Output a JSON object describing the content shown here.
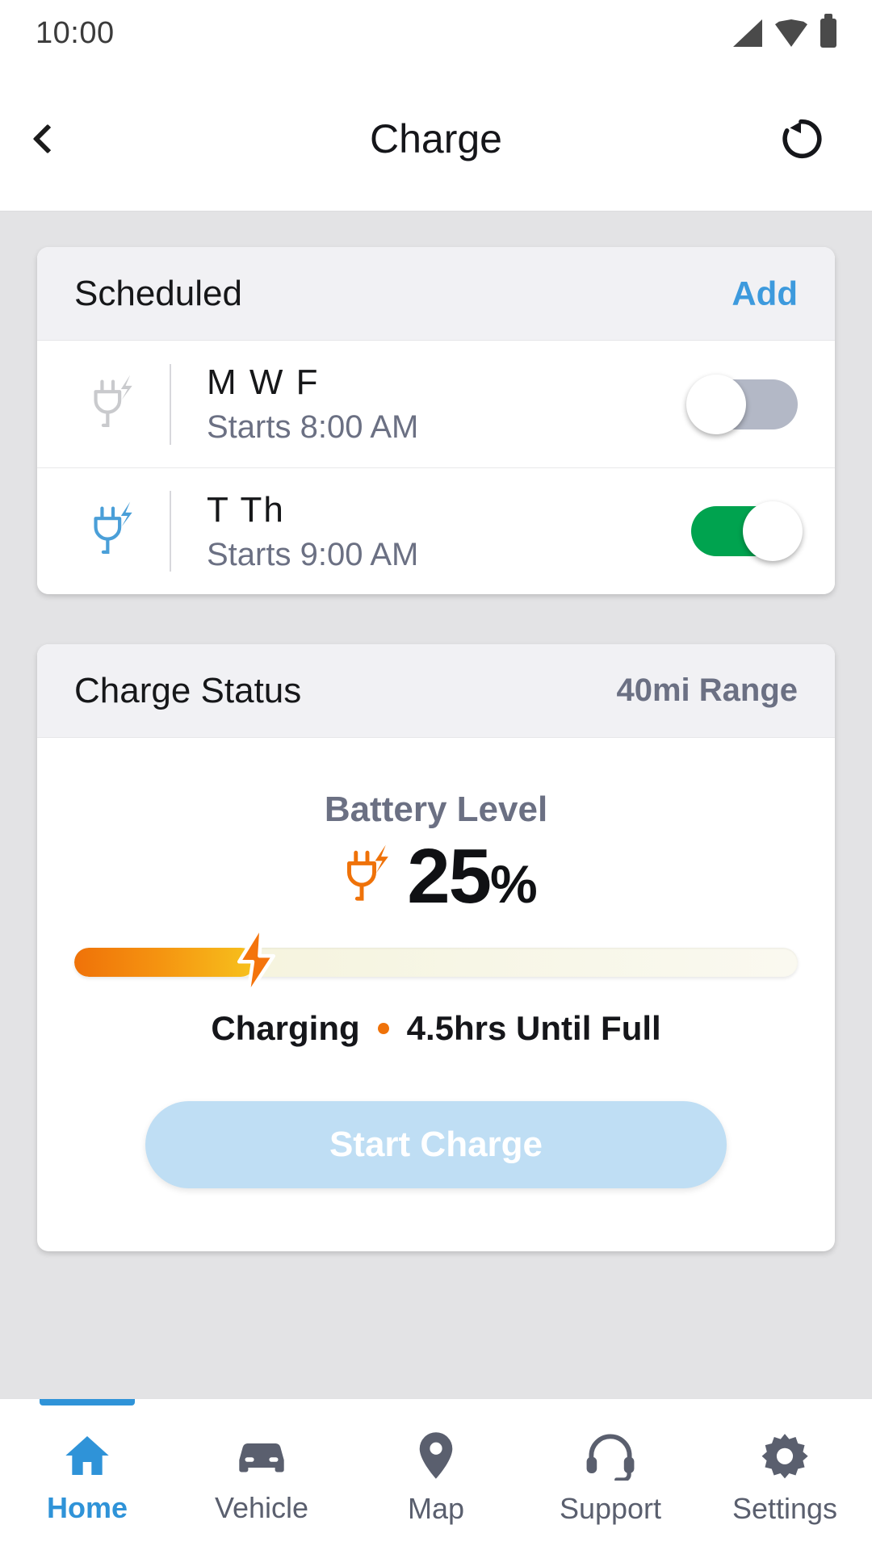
{
  "statusbar": {
    "time": "10:00",
    "icons": [
      "signal-icon",
      "wifi-icon",
      "battery-icon"
    ]
  },
  "appbar": {
    "back_icon": "chevron-left-icon",
    "title": "Charge",
    "refresh_icon": "refresh-counterclockwise-icon"
  },
  "scheduled_card": {
    "title": "Scheduled",
    "add_label": "Add",
    "rows": [
      {
        "icon": "plug-bolt-icon",
        "icon_color": "#c9cacd",
        "days": "M W F",
        "time": "Starts 8:00 AM",
        "enabled": false
      },
      {
        "icon": "plug-bolt-icon",
        "icon_color": "#4a9fd8",
        "days": "T Th",
        "time": "Starts 9:00 AM",
        "enabled": true
      }
    ]
  },
  "charge_status_card": {
    "title": "Charge Status",
    "range": "40mi Range",
    "battery_label": "Battery Level",
    "plug_icon": "plug-bolt-icon",
    "battery_percent_value": "25",
    "battery_percent_unit": "%",
    "battery_percent_number": 25,
    "bolt_icon": "lightning-bolt-icon",
    "charging_state": "Charging",
    "separator": "•",
    "time_until_full": "4.5hrs Until Full",
    "start_button_label": "Start Charge"
  },
  "bottom_nav": {
    "items": [
      {
        "label": "Home",
        "icon": "home-icon",
        "active": true
      },
      {
        "label": "Vehicle",
        "icon": "car-icon",
        "active": false
      },
      {
        "label": "Map",
        "icon": "map-pin-icon",
        "active": false
      },
      {
        "label": "Support",
        "icon": "headset-icon",
        "active": false
      },
      {
        "label": "Settings",
        "icon": "gear-icon",
        "active": false
      }
    ]
  },
  "colors": {
    "accent_blue": "#2f93d8",
    "link_blue": "#3d9add",
    "toggle_on_green": "#00a34f",
    "toggle_off_gray": "#b3b8c6",
    "charge_orange": "#ef7209",
    "charge_yellow": "#f7c21d",
    "button_disabled_blue": "#bfdef4",
    "muted_text": "#6b7083",
    "page_background": "#e3e3e5"
  }
}
